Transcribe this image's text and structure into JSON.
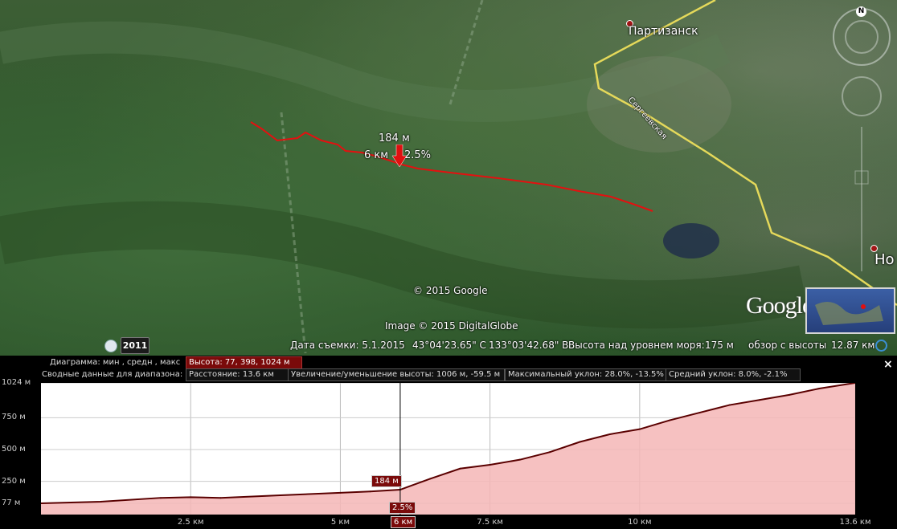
{
  "map": {
    "cities": [
      {
        "name": "Партизанск"
      },
      {
        "name": "Но"
      }
    ],
    "road_label": "Сергеевская",
    "copyright_google": "© 2015 Google",
    "copyright_imagery": "Image © 2015 DigitalGlobe",
    "logo_text": "Google earth",
    "marker": {
      "elevation": "184 м",
      "distance": "6 км",
      "slope": "2.5%"
    },
    "compass_letter": "N"
  },
  "status_bar": {
    "year": "2011",
    "date_label": "Дата съемки: 5.1.2015",
    "lat": "43°04'23.65\" С",
    "lon": "133°03'42.68\" В",
    "elevation_label": "Высота над уровнем моря:",
    "elevation_value": "175 м",
    "eye_alt_label": "обзор с высоты",
    "eye_alt_value": "12.87 км"
  },
  "profile": {
    "row1_label": "Диаграмма: мин , средн , макс",
    "row1_value": "Высота: 77, 398, 1024 м",
    "row2_label": "Сводные данные для диапазона:",
    "stats": [
      "Расстояние: 13.6 км",
      "Увеличение/уменьшение высоты: 1006 м, -59.5 м",
      "Максимальный уклон: 28.0%, -13.5%",
      "Средний уклон: 8.0%, -2.1%"
    ],
    "close_label": "×",
    "cursor": {
      "elevation": "184 м",
      "slope": "2.5%",
      "distance": "6 км"
    }
  },
  "chart_data": {
    "type": "area",
    "xlabel": "",
    "ylabel": "",
    "xlim": [
      0,
      13.6
    ],
    "ylim": [
      77,
      1024
    ],
    "x_ticks": [
      "2.5 км",
      "5 км",
      "7.5 км",
      "10 км",
      "13.6 км"
    ],
    "x_tick_values": [
      2.5,
      5,
      7.5,
      10,
      13.6
    ],
    "y_ticks": [
      "1024 м",
      "750 м",
      "500 м",
      "250 м",
      "77 м"
    ],
    "y_tick_values": [
      1024,
      750,
      500,
      250,
      77
    ],
    "x": [
      0,
      1,
      2,
      2.5,
      3,
      4,
      5,
      5.5,
      6,
      6.5,
      7,
      7.5,
      8,
      8.5,
      9,
      9.5,
      10,
      10.5,
      11,
      11.5,
      12,
      12.5,
      13,
      13.6
    ],
    "y": [
      77,
      90,
      120,
      125,
      120,
      140,
      160,
      170,
      184,
      270,
      350,
      380,
      420,
      480,
      560,
      620,
      660,
      730,
      790,
      850,
      890,
      930,
      980,
      1024
    ],
    "fill_color": "#f4b6b6",
    "line_color": "#5a0000"
  }
}
